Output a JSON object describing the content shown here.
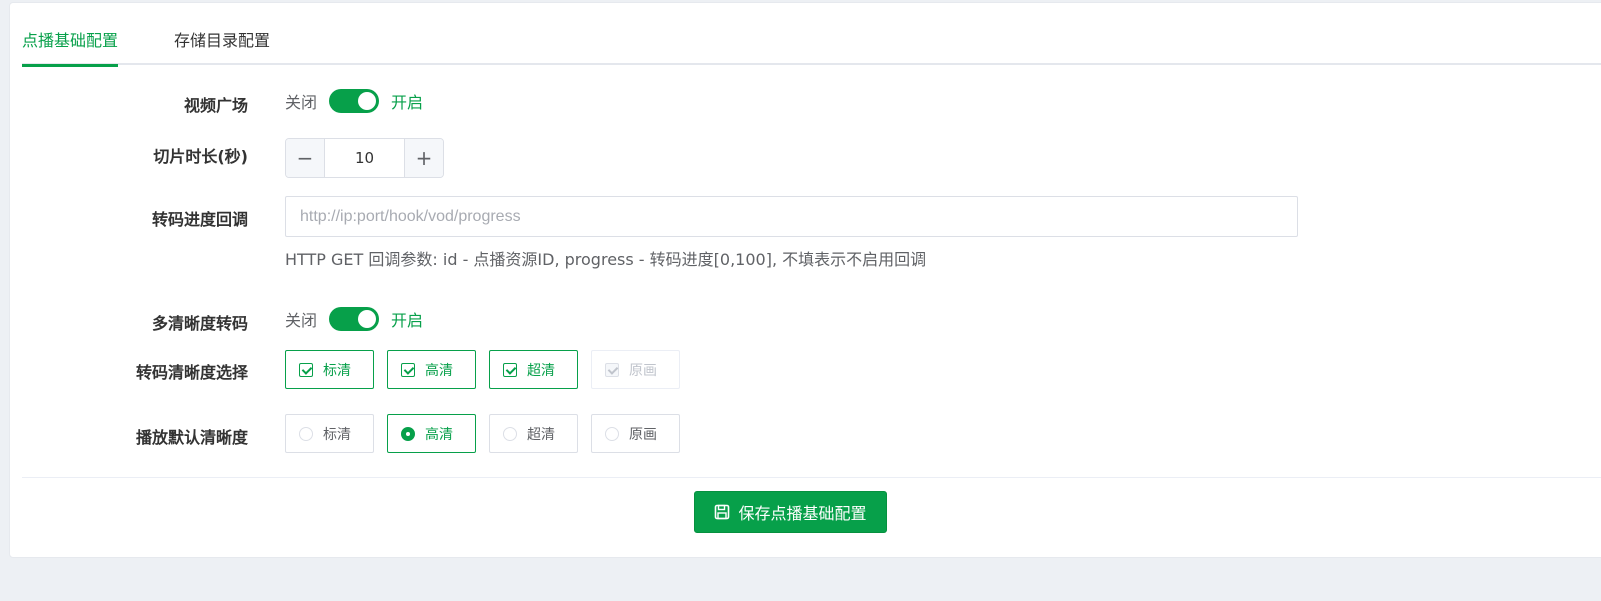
{
  "tabs": [
    {
      "label": "点播基础配置",
      "active": true
    },
    {
      "label": "存储目录配置",
      "active": false
    }
  ],
  "video_square": {
    "label": "视频广场",
    "off_text": "关闭",
    "on_text": "开启",
    "enabled": true
  },
  "slice_duration": {
    "label": "切片时长(秒)",
    "value": "10",
    "minus_symbol": "−",
    "plus_symbol": "+"
  },
  "progress_callback": {
    "label": "转码进度回调",
    "value": "",
    "placeholder": "http://ip:port/hook/vod/progress",
    "hint": "HTTP GET 回调参数: id - 点播资源ID, progress - 转码进度[0,100], 不填表示不启用回调"
  },
  "multi_definition": {
    "label": "多清晰度转码",
    "off_text": "关闭",
    "on_text": "开启",
    "enabled": true
  },
  "definition_select": {
    "label": "转码清晰度选择",
    "options": [
      {
        "label": "标清",
        "checked": true,
        "disabled": false
      },
      {
        "label": "高清",
        "checked": true,
        "disabled": false
      },
      {
        "label": "超清",
        "checked": true,
        "disabled": false
      },
      {
        "label": "原画",
        "checked": true,
        "disabled": true
      }
    ]
  },
  "default_definition": {
    "label": "播放默认清晰度",
    "options": [
      {
        "label": "标清",
        "selected": false
      },
      {
        "label": "高清",
        "selected": true
      },
      {
        "label": "超清",
        "selected": false
      },
      {
        "label": "原画",
        "selected": false
      }
    ]
  },
  "save_button": {
    "label": "保存点播基础配置",
    "icon": "save-icon"
  },
  "colors": {
    "accent": "#07a04a",
    "background": "#edf0f4",
    "border": "#dcdfe6"
  }
}
